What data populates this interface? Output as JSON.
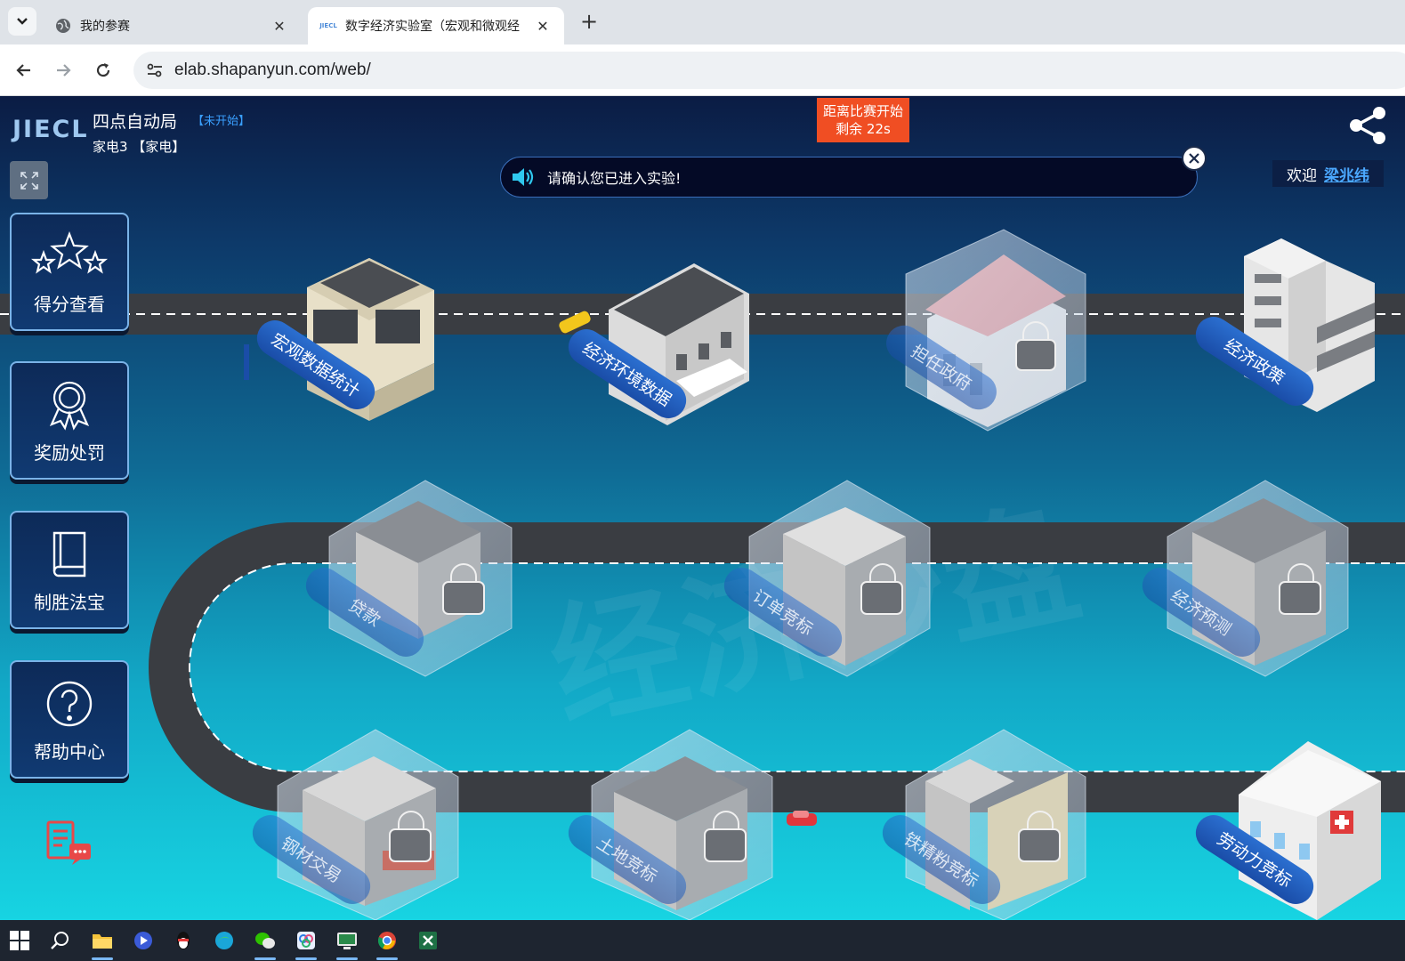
{
  "browser": {
    "tabs": [
      {
        "title": "我的参赛",
        "active": false
      },
      {
        "title": "数字经济实验室（宏观和微观经",
        "active": true,
        "favicon_text": "JIECL"
      }
    ],
    "url": "elab.shapanyun.com/web/"
  },
  "header": {
    "logo": "JIECL",
    "experiment_title": "四点自动局",
    "experiment_status": "【未开始】",
    "team": "家电3 【家电】",
    "countdown_line1": "距离比赛开始",
    "countdown_line2": "剩余 22s",
    "notice": "请确认您已进入实验!",
    "welcome_label": "欢迎",
    "username": "梁兆纬"
  },
  "sidebar": [
    {
      "label": "得分查看",
      "icon": "stars-icon"
    },
    {
      "label": "奖励处罚",
      "icon": "award-ribbon-icon"
    },
    {
      "label": "制胜法宝",
      "icon": "book-icon"
    },
    {
      "label": "帮助中心",
      "icon": "question-circle-icon"
    }
  ],
  "buildings": [
    {
      "label": "宏观数据统计",
      "locked": false
    },
    {
      "label": "经济环境数据",
      "locked": false
    },
    {
      "label": "担任政府",
      "locked": true
    },
    {
      "label": "经济政策",
      "locked": false
    },
    {
      "label": "贷款",
      "locked": true
    },
    {
      "label": "订单竞标",
      "locked": true
    },
    {
      "label": "经济预测",
      "locked": true
    },
    {
      "label": "钢材交易",
      "locked": true
    },
    {
      "label": "土地竞标",
      "locked": true
    },
    {
      "label": "铁精粉竞标",
      "locked": true
    },
    {
      "label": "劳动力竞标",
      "locked": false
    }
  ],
  "watermark": "经济沙盘",
  "colors": {
    "accent_orange": "#f04e23",
    "link_blue": "#4ba8ff",
    "road": "#3a3d42",
    "lock_cube": "#c8d6e6"
  }
}
